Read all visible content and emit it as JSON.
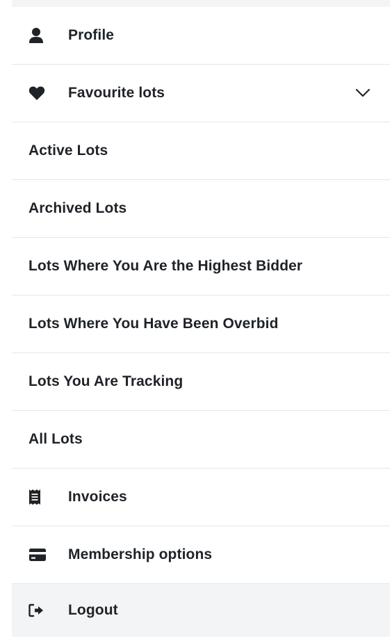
{
  "menu": {
    "profile": {
      "label": "Profile",
      "icon": "user-icon"
    },
    "favourite": {
      "label": "Favourite lots",
      "icon": "heart-icon",
      "toggle_icon": "chevron-down-icon"
    },
    "active_lots": {
      "label": "Active Lots"
    },
    "archived_lots": {
      "label": "Archived Lots"
    },
    "highest_bidder": {
      "label": "Lots Where You Are the Highest Bidder"
    },
    "overbid": {
      "label": "Lots Where You Have Been Overbid"
    },
    "tracking": {
      "label": "Lots You Are Tracking"
    },
    "all_lots": {
      "label": "All Lots"
    },
    "invoices": {
      "label": "Invoices",
      "icon": "receipt-icon"
    },
    "membership": {
      "label": "Membership options",
      "icon": "credit-card-icon"
    },
    "logout": {
      "label": "Logout",
      "icon": "logout-icon"
    }
  },
  "colors": {
    "text": "#1f2328",
    "divider": "#e4e6ea",
    "highlight_bg": "#f3f4f6"
  }
}
